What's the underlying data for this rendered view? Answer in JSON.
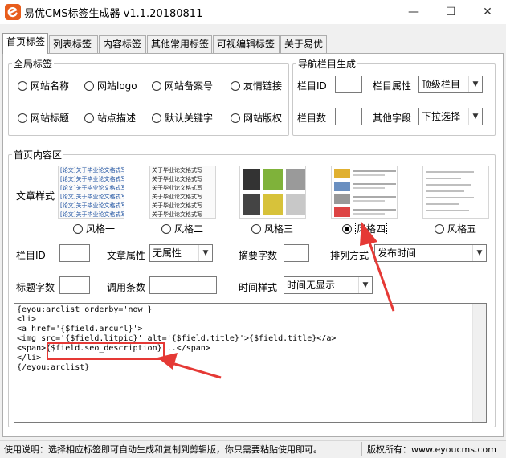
{
  "window": {
    "title": "易优CMS标签生成器 v1.1.20180811",
    "minimize": "—",
    "maximize": "☐",
    "close": "✕"
  },
  "tabs": [
    {
      "label": "首页标签",
      "active": true
    },
    {
      "label": "列表标签"
    },
    {
      "label": "内容标签"
    },
    {
      "label": "其他常用标签"
    },
    {
      "label": "可视编辑标签"
    },
    {
      "label": "关于易优"
    }
  ],
  "global": {
    "legend": "全局标签",
    "options": [
      "网站名称",
      "网站logo",
      "网站备案号",
      "友情链接",
      "网站标题",
      "站点描述",
      "默认关键字",
      "网站版权"
    ]
  },
  "nav": {
    "legend": "导航栏目生成",
    "col_id_label": "栏目ID",
    "col_id_value": "",
    "col_attr_label": "栏目属性",
    "col_attr_value": "顶级栏目",
    "col_count_label": "栏目数",
    "col_count_value": "",
    "other_label": "其他字段",
    "other_value": "下拉选择"
  },
  "home": {
    "legend": "首页内容区",
    "style_label": "文章样式",
    "styles": [
      "风格一",
      "风格二",
      "风格三",
      "风格四",
      "风格五"
    ],
    "selected_style": 3,
    "thumb_text_1": "[论文]关于毕业论文格式写",
    "thumb_text_2": "关于毕业论文格式写",
    "col_id_label": "栏目ID",
    "col_id_value": "",
    "article_attr_label": "文章属性",
    "article_attr_value": "无属性",
    "summary_label": "摘要字数",
    "summary_value": "",
    "sort_label": "排列方式",
    "sort_value": "发布时间",
    "title_len_label": "标题字数",
    "title_len_value": "",
    "call_count_label": "调用条数",
    "call_count_value": "",
    "time_style_label": "时间样式",
    "time_style_value": "时间无显示"
  },
  "code": {
    "lines": [
      "{eyou:arclist orderby='now'}",
      "<li>",
      "<a href='{$field.arcurl}'>",
      "<img src='{$field.litpic}' alt='{$field.title}'>{$field.title}</a>",
      "<span>{$field.seo_description}...</span>",
      "</li>",
      "{/eyou:arclist}"
    ]
  },
  "status": {
    "usage": "使用说明：选择相应标签即可自动生成和复制到剪辑版，你只需要粘贴使用即可。",
    "copyright": "版权所有：www.eyoucms.com"
  },
  "colors": {
    "accent": "#e85d1c",
    "annotation": "#e53935"
  }
}
